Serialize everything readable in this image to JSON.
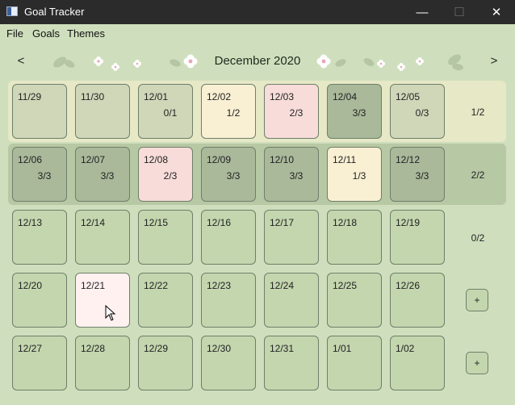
{
  "window": {
    "title": "Goal Tracker",
    "minimize_glyph": "—",
    "maximize_glyph": "☐",
    "close_glyph": "✕"
  },
  "menu": {
    "items": [
      "File",
      "Goals",
      "Themes"
    ]
  },
  "header": {
    "title": "December 2020",
    "prev_glyph": "<",
    "next_glyph": ">"
  },
  "colors": {
    "background": "#cfdfbd",
    "default_cell": "#c3d6ae",
    "complete_cell": "#a9b99a",
    "partial_cell": "#f9efd3",
    "low_cell": "#f7dcd9",
    "empty_goal_cell": "#d0d6b8",
    "today_cell": "#fff1f0",
    "row1_band": "#e6e8c6",
    "row2_band": "#b7c8a4"
  },
  "weeks": [
    {
      "summary": "1/2",
      "action": null,
      "days": [
        {
          "date": "11/29",
          "count": "",
          "status": "outside"
        },
        {
          "date": "11/30",
          "count": "",
          "status": "outside"
        },
        {
          "date": "12/01",
          "count": "0/1",
          "status": "empty_goal"
        },
        {
          "date": "12/02",
          "count": "1/2",
          "status": "partial"
        },
        {
          "date": "12/03",
          "count": "2/3",
          "status": "low"
        },
        {
          "date": "12/04",
          "count": "3/3",
          "status": "complete"
        },
        {
          "date": "12/05",
          "count": "0/3",
          "status": "empty_goal"
        }
      ]
    },
    {
      "summary": "2/2",
      "action": null,
      "days": [
        {
          "date": "12/06",
          "count": "3/3",
          "status": "complete"
        },
        {
          "date": "12/07",
          "count": "3/3",
          "status": "complete"
        },
        {
          "date": "12/08",
          "count": "2/3",
          "status": "low"
        },
        {
          "date": "12/09",
          "count": "3/3",
          "status": "complete"
        },
        {
          "date": "12/10",
          "count": "3/3",
          "status": "complete"
        },
        {
          "date": "12/11",
          "count": "1/3",
          "status": "partial"
        },
        {
          "date": "12/12",
          "count": "3/3",
          "status": "complete"
        }
      ]
    },
    {
      "summary": "0/2",
      "action": null,
      "days": [
        {
          "date": "12/13",
          "count": "",
          "status": "default"
        },
        {
          "date": "12/14",
          "count": "",
          "status": "default"
        },
        {
          "date": "12/15",
          "count": "",
          "status": "default"
        },
        {
          "date": "12/16",
          "count": "",
          "status": "default"
        },
        {
          "date": "12/17",
          "count": "",
          "status": "default"
        },
        {
          "date": "12/18",
          "count": "",
          "status": "default"
        },
        {
          "date": "12/19",
          "count": "",
          "status": "default"
        }
      ]
    },
    {
      "summary": null,
      "action": "+",
      "days": [
        {
          "date": "12/20",
          "count": "",
          "status": "default"
        },
        {
          "date": "12/21",
          "count": "",
          "status": "today"
        },
        {
          "date": "12/22",
          "count": "",
          "status": "default"
        },
        {
          "date": "12/23",
          "count": "",
          "status": "default"
        },
        {
          "date": "12/24",
          "count": "",
          "status": "default"
        },
        {
          "date": "12/25",
          "count": "",
          "status": "default"
        },
        {
          "date": "12/26",
          "count": "",
          "status": "default"
        }
      ]
    },
    {
      "summary": null,
      "action": "+",
      "days": [
        {
          "date": "12/27",
          "count": "",
          "status": "default"
        },
        {
          "date": "12/28",
          "count": "",
          "status": "default"
        },
        {
          "date": "12/29",
          "count": "",
          "status": "default"
        },
        {
          "date": "12/30",
          "count": "",
          "status": "default"
        },
        {
          "date": "12/31",
          "count": "",
          "status": "default"
        },
        {
          "date": "1/01",
          "count": "",
          "status": "default"
        },
        {
          "date": "1/02",
          "count": "",
          "status": "default"
        }
      ]
    }
  ]
}
